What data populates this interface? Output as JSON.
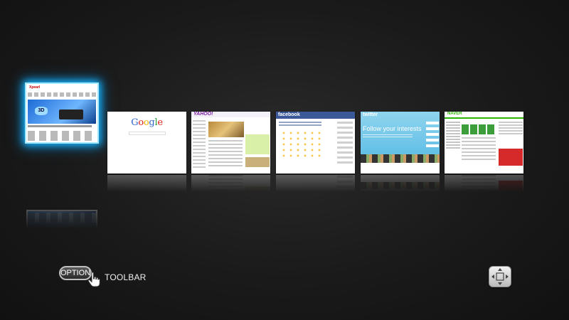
{
  "tabs": [
    {
      "id": "shop",
      "logo_text": "Xpearl",
      "banner_text": "3D"
    },
    {
      "id": "google",
      "logo_text": "Google"
    },
    {
      "id": "yahoo",
      "logo_text": "YAHOO!"
    },
    {
      "id": "facebook",
      "logo_text": "facebook"
    },
    {
      "id": "twitter",
      "logo_text": "twitter",
      "headline": "Follow your interests"
    },
    {
      "id": "naver",
      "logo_text": "NAVER"
    }
  ],
  "bottom": {
    "option_label": "OPTION",
    "toolbar_label": "TOOLBAR"
  },
  "colors": {
    "selection_glow": "#1cb6ff",
    "background": "#1a1a1a"
  },
  "icons": {
    "option": "hand-pointer-icon",
    "move": "four-arrows-icon"
  }
}
